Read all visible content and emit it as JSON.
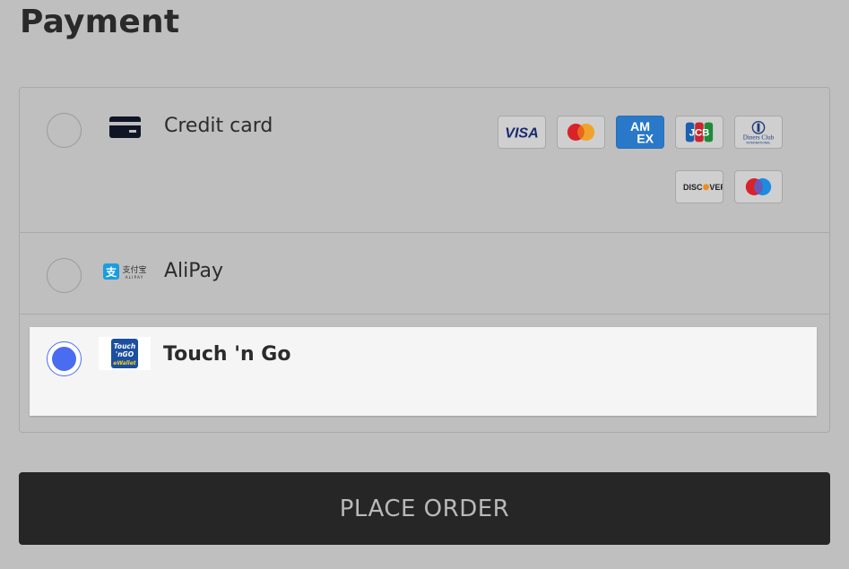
{
  "title": "Payment",
  "options": {
    "credit_card": {
      "label": "Credit card",
      "selected": false
    },
    "alipay": {
      "label": "AliPay",
      "selected": false,
      "logo_cn": "支付宝",
      "logo_en": "ALIPAY"
    },
    "tng": {
      "label": "Touch 'n Go",
      "selected": true,
      "logo_line1": "Touch",
      "logo_line2": "'nGO",
      "logo_line3": "eWallet"
    }
  },
  "brands": {
    "visa": "VISA",
    "amex_1": "AM",
    "amex_2": "EX",
    "jcb": "JCB",
    "diners_1": "Diners Club",
    "diners_2": "INTERNATIONAL",
    "discover_1": "DISC",
    "discover_2": "VER"
  },
  "place_order_label": "PLACE ORDER",
  "colors": {
    "accent": "#4a6cf0",
    "background": "#bfbfbf",
    "button": "#262626",
    "selected_panel": "#f5f5f5"
  }
}
